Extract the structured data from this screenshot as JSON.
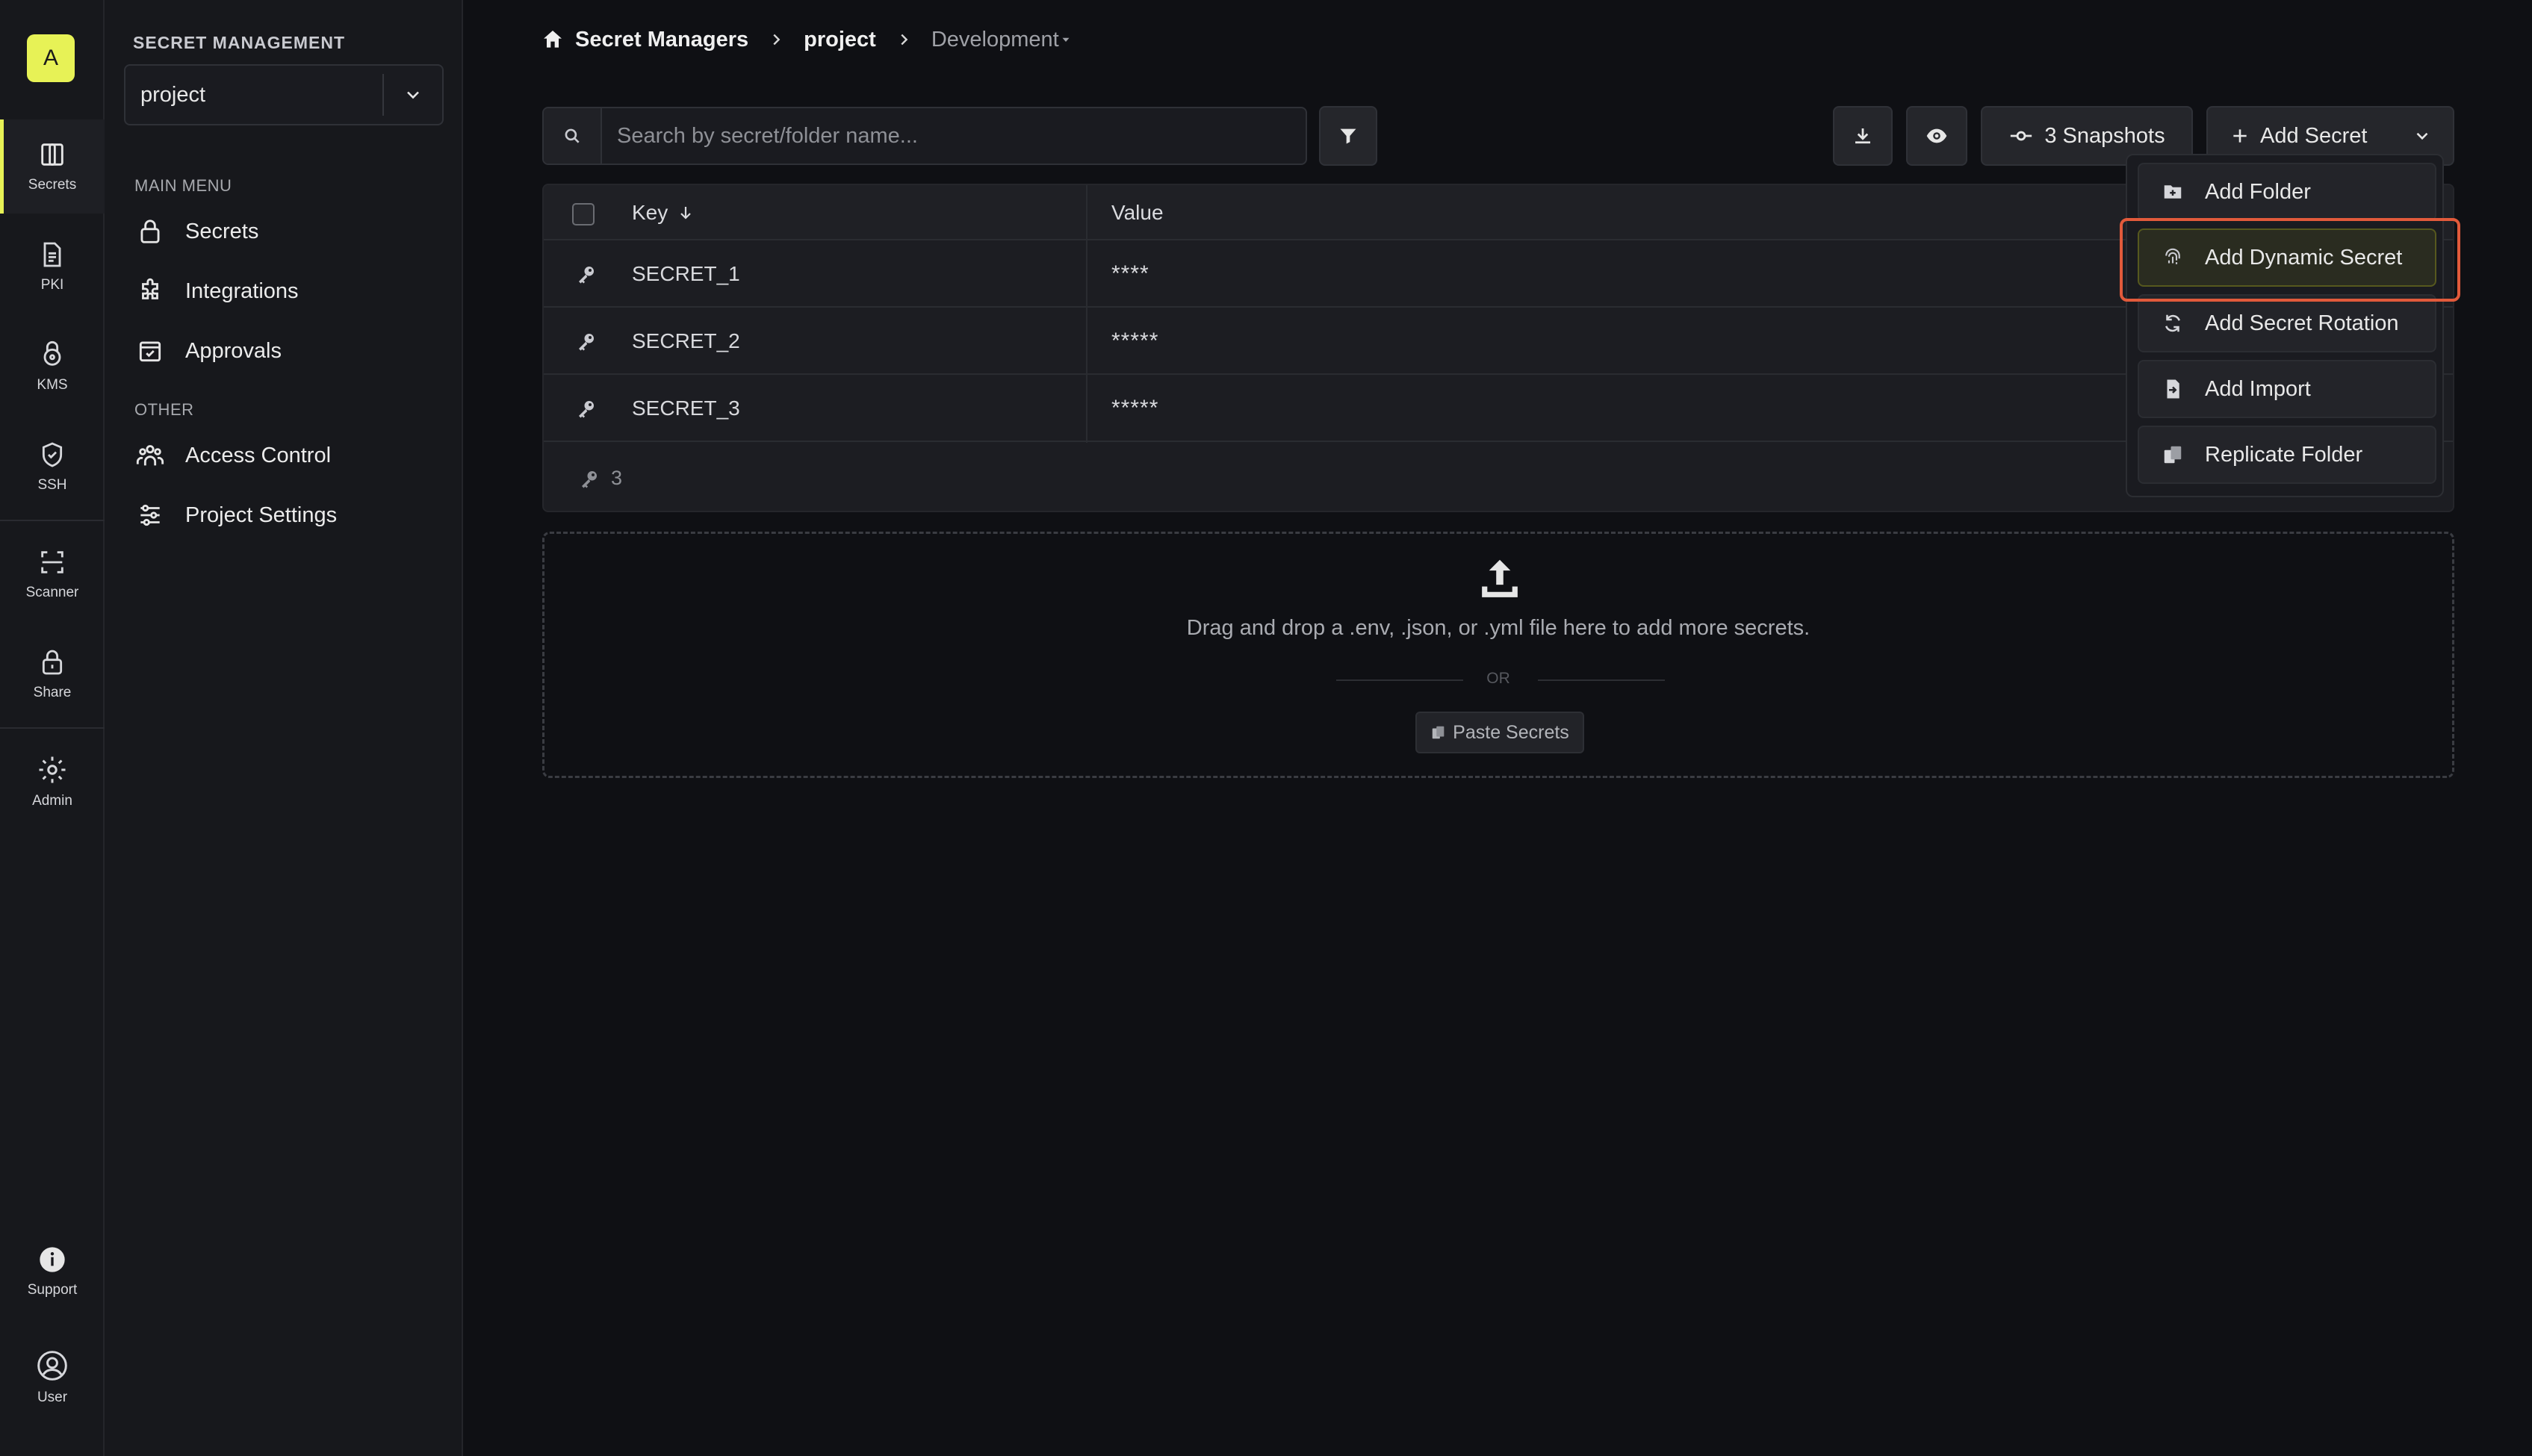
{
  "rail": {
    "logo_letter": "A",
    "items": [
      {
        "label": "Secrets",
        "icon": "secrets-icon"
      },
      {
        "label": "PKI",
        "icon": "document-icon"
      },
      {
        "label": "KMS",
        "icon": "lock-badge-icon"
      },
      {
        "label": "SSH",
        "icon": "shield-check-icon"
      },
      {
        "label": "Scanner",
        "icon": "scan-icon"
      },
      {
        "label": "Share",
        "icon": "lock-icon"
      },
      {
        "label": "Admin",
        "icon": "gear-icon"
      },
      {
        "label": "Support",
        "icon": "info-icon"
      },
      {
        "label": "User",
        "icon": "user-circle-icon"
      }
    ]
  },
  "sidebar": {
    "heading": "SECRET MANAGEMENT",
    "project_value": "project",
    "main_menu_label": "MAIN MENU",
    "main_items": [
      {
        "label": "Secrets",
        "icon": "lock-icon"
      },
      {
        "label": "Integrations",
        "icon": "puzzle-icon"
      },
      {
        "label": "Approvals",
        "icon": "calendar-check-icon"
      }
    ],
    "other_label": "OTHER",
    "other_items": [
      {
        "label": "Access Control",
        "icon": "users-icon"
      },
      {
        "label": "Project Settings",
        "icon": "sliders-icon"
      }
    ]
  },
  "breadcrumb": {
    "root": "Secret Managers",
    "project": "project",
    "environment": "Development"
  },
  "toolbar": {
    "search_placeholder": "Search by secret/folder name...",
    "snapshots_label": "3 Snapshots",
    "add_secret_label": "Add Secret"
  },
  "table": {
    "columns": [
      "Key",
      "Value"
    ],
    "rows": [
      {
        "key": "SECRET_1",
        "value": "****"
      },
      {
        "key": "SECRET_2",
        "value": "*****"
      },
      {
        "key": "SECRET_3",
        "value": "*****"
      }
    ],
    "count": "3"
  },
  "dropzone": {
    "text": "Drag and drop a .env, .json, or .yml file here to add more secrets.",
    "or": "OR",
    "paste_label": "Paste Secrets"
  },
  "dropdown": {
    "items": [
      {
        "label": "Add Folder",
        "icon": "folder-plus-icon"
      },
      {
        "label": "Add Dynamic Secret",
        "icon": "fingerprint-icon"
      },
      {
        "label": "Add Secret Rotation",
        "icon": "refresh-icon"
      },
      {
        "label": "Add Import",
        "icon": "file-import-icon"
      },
      {
        "label": "Replicate Folder",
        "icon": "copy-icon"
      }
    ]
  },
  "colors": {
    "accent": "#e7f256",
    "highlight": "#e25a3b",
    "background": "#0f1014"
  }
}
